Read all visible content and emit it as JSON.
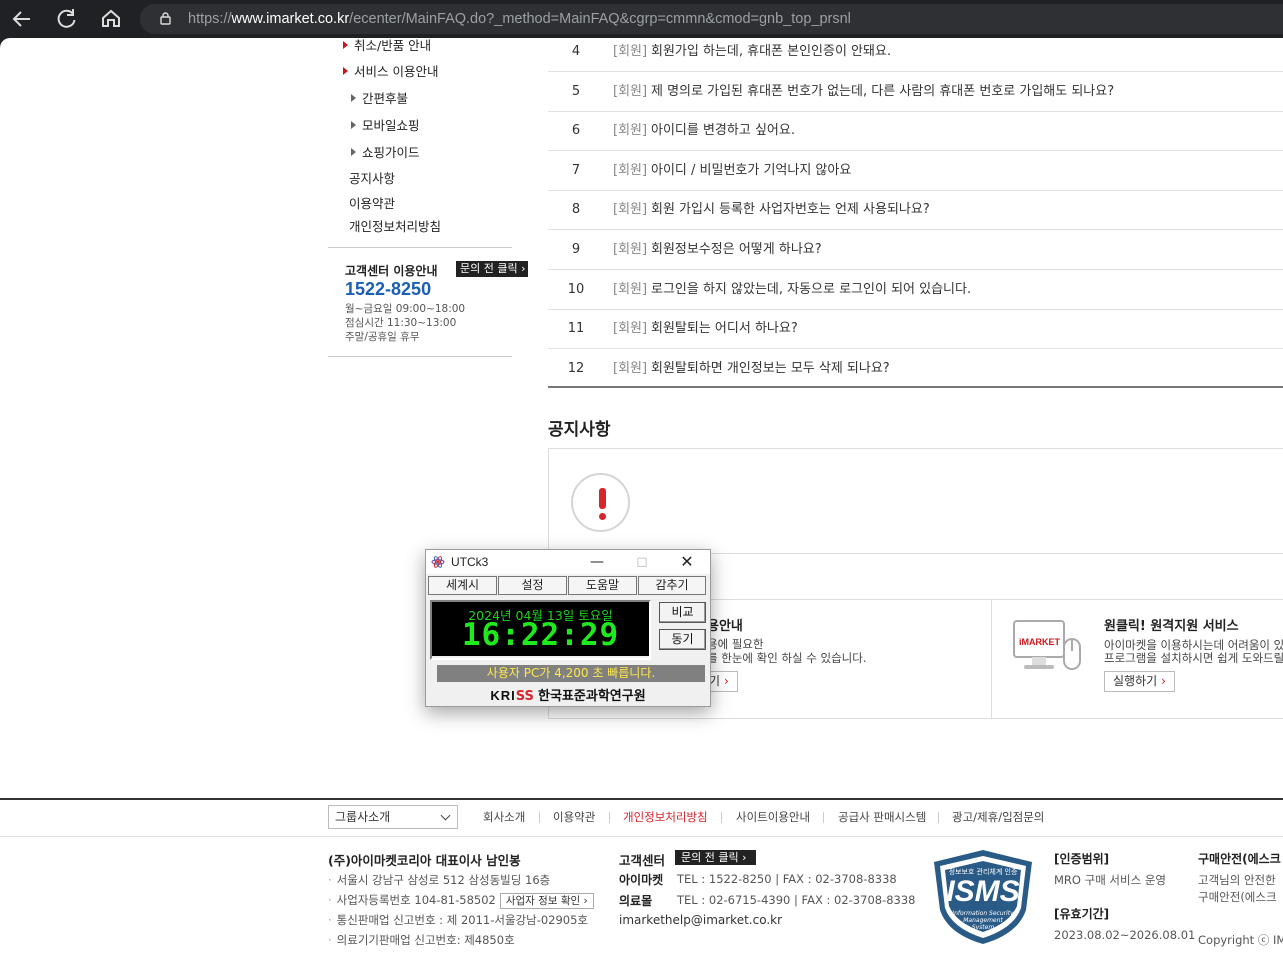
{
  "browser": {
    "url_prefix": "https://",
    "url_domain": "www.imarket.co.kr",
    "url_path": "/ecenter/MainFAQ.do?_method=MainFAQ&cgrp=cmmn&cmod=gnb_top_prsnl"
  },
  "left_menu": {
    "items": [
      {
        "label": "취소/반품 안내"
      },
      {
        "label": "서비스 이용안내"
      },
      {
        "label": "간편후불"
      },
      {
        "label": "모바일쇼핑"
      },
      {
        "label": "쇼핑가이드"
      },
      {
        "label": "공지사항"
      },
      {
        "label": "이용약관"
      },
      {
        "label": "개인정보처리방침"
      }
    ],
    "cs": {
      "title": "고객센터 이용안내",
      "button": "문의 전 클릭",
      "phone": "1522-8250",
      "hours": [
        "월~금요일 09:00~18:00",
        "점심시간 11:30~13:00",
        "주말/공휴일 휴무"
      ]
    }
  },
  "faq": {
    "rows": [
      {
        "num": "4",
        "cat": "[회원]",
        "q": "회원가입 하는데, 휴대폰 본인인증이 안돼요."
      },
      {
        "num": "5",
        "cat": "[회원]",
        "q": "제 명의로 가입된 휴대폰 번호가 없는데, 다른 사람의 휴대폰 번호로 가입해도 되나요?"
      },
      {
        "num": "6",
        "cat": "[회원]",
        "q": "아이디를 변경하고 싶어요."
      },
      {
        "num": "7",
        "cat": "[회원]",
        "q": "아이디 / 비밀번호가 기억나지 않아요"
      },
      {
        "num": "8",
        "cat": "[회원]",
        "q": "회원 가입시 등록한 사업자번호는 언제 사용되나요?"
      },
      {
        "num": "9",
        "cat": "[회원]",
        "q": "회원정보수정은 어떻게 하나요?"
      },
      {
        "num": "10",
        "cat": "[회원]",
        "q": "로그인을 하지 않았는데, 자동으로 로그인이 되어 있습니다."
      },
      {
        "num": "11",
        "cat": "[회원]",
        "q": "회원탈퇴는 어디서 하나요?"
      },
      {
        "num": "12",
        "cat": "[회원]",
        "q": "회원탈퇴하면 개인정보는 모두 삭제 되나요?"
      }
    ]
  },
  "notice": {
    "title": "공지사항"
  },
  "services": {
    "left": {
      "title": "용안내",
      "desc1": "용에 필요한",
      "desc2": "를 한눈에 확인 하실 수 있습니다.",
      "button": "기"
    },
    "right": {
      "title": "원클릭! 원격지원 서비스",
      "desc1": "아이마켓을 이용하시는데 어려움이 있으",
      "desc2": "프로그램을 설치하시면 쉽게 도와드릴 수",
      "button": "실행하기",
      "logo_text": "iMARKET"
    }
  },
  "footer": {
    "group_select": "그룹사소개",
    "links": [
      {
        "label": "회사소개"
      },
      {
        "label": "이용약관"
      },
      {
        "label": "개인정보처리방침"
      },
      {
        "label": "사이트이용안내"
      },
      {
        "label": "공급사 판매시스템"
      },
      {
        "label": "광고/제휴/입점문의"
      }
    ],
    "company": "(주)아이마켓코리아  대표이사 남인봉",
    "address": "서울시 강남구 삼성로 512 삼성동빌딩 16층",
    "bizno": "사업자등록번호 104-81-58502",
    "biz_button": "사업자 정보 확인",
    "telecom": "통신판매업 신고번호 : 제 2011-서울강남-02905호",
    "medical": "의료기기판매업 신고번호: 제4850호",
    "cc_title": "고객센터",
    "cc_button": "문의 전 클릭",
    "cc_imarket_label": "아이마켓",
    "cc_imarket": "TEL : 1522-8250  |  FAX : 02-3708-8338",
    "cc_medical_label": "의료몰",
    "cc_medical": "TEL : 02-6715-4390  |  FAX : 02-3708-8338",
    "cc_email": "imarkethelp@imarket.co.kr",
    "isms_top": "정보보호 관리체계 인증",
    "isms_main": "ISMS",
    "isms_sub1": "Information Security",
    "isms_sub2": "Management",
    "isms_sub3": "System",
    "cert_scope_h": "[인증범위]",
    "cert_scope": "MRO 구매 서비스 운영",
    "cert_period_h": "[유효기간]",
    "cert_period": "2023.08.02~2026.08.01",
    "safe_h": "구매안전(에스크",
    "safe_1": "고객님의 안전한",
    "safe_2": "구매안전(에스크",
    "copyright": "Copyright ⓒ IM"
  },
  "utck": {
    "title": "UTCk3",
    "menu": [
      "세계시",
      "설정",
      "도움말",
      "감추기"
    ],
    "date": "2024년 04월 13일 토요일",
    "time": "16:22:29",
    "btn_compare": "비교",
    "btn_sync": "동기",
    "status": "사용자 PC가 4,200 초 빠릅니다.",
    "brand_k": "KRI",
    "brand_s": "SS",
    "brand_name": "한국표준과학연구원"
  }
}
